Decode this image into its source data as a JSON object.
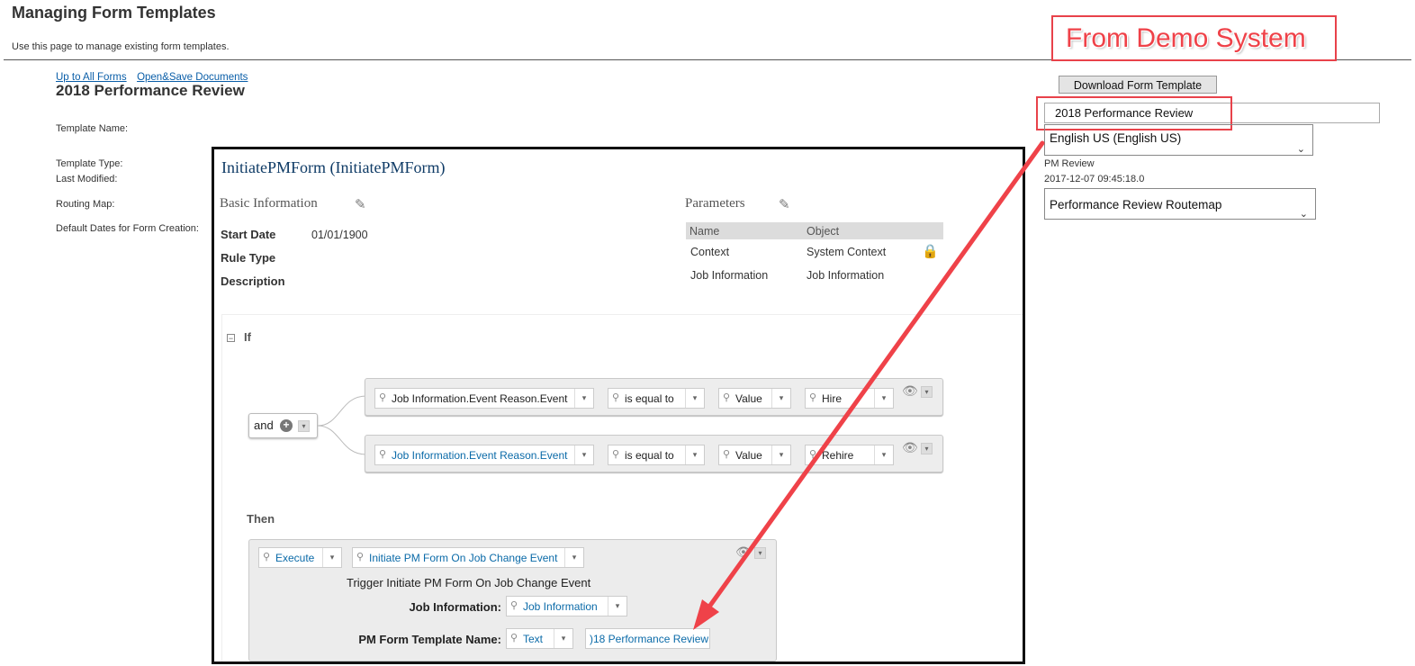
{
  "page": {
    "title": "Managing Form Templates",
    "description": "Use this page to manage existing form templates."
  },
  "breadcrumbs": {
    "up_link": "Up to All Forms",
    "open_save_link": "Open&Save Documents"
  },
  "form": {
    "title": "2018 Performance Review",
    "labels": {
      "template_name": "Template Name:",
      "template_type": "Template Type:",
      "last_modified": "Last Modified:",
      "routing_map": "Routing Map:",
      "default_dates": "Default Dates for Form Creation:"
    },
    "download_button": "Download Form Template",
    "template_name_value": "2018 Performance Review",
    "language_value": "English US (English US)",
    "template_type_value": "PM Review",
    "last_modified_value": "2017-12-07 09:45:18.0",
    "routing_map_value": "Performance Review Routemap"
  },
  "annotation": {
    "label": "From Demo System",
    "color": "#ef4249"
  },
  "rule": {
    "title": "InitiatePMForm (InitiatePMForm)",
    "basic_info": {
      "heading": "Basic Information",
      "start_date_label": "Start Date",
      "start_date_value": "01/01/1900",
      "rule_type_label": "Rule Type",
      "description_label": "Description"
    },
    "parameters": {
      "heading": "Parameters",
      "col_name": "Name",
      "col_object": "Object",
      "rows": [
        {
          "name": "Context",
          "object": "System Context"
        },
        {
          "name": "Job Information",
          "object": "Job Information"
        }
      ]
    },
    "if_label": "If",
    "and_label": "and",
    "conditions": [
      {
        "field": "Job Information.Event Reason.Event",
        "operator": "is equal to",
        "type": "Value",
        "value": "Hire"
      },
      {
        "field": "Job Information.Event Reason.Event",
        "operator": "is equal to",
        "type": "Value",
        "value": "Rehire"
      }
    ],
    "then_label": "Then",
    "then": {
      "action": "Execute",
      "function": "Initiate PM Form On Job Change Event",
      "description": "Trigger Initiate PM Form On Job Change Event",
      "job_info_label": "Job Information:",
      "job_info_value": "Job Information",
      "pm_form_label": "PM Form Template Name:",
      "pm_form_type": "Text",
      "pm_form_value": ")18 Performance Review"
    }
  }
}
